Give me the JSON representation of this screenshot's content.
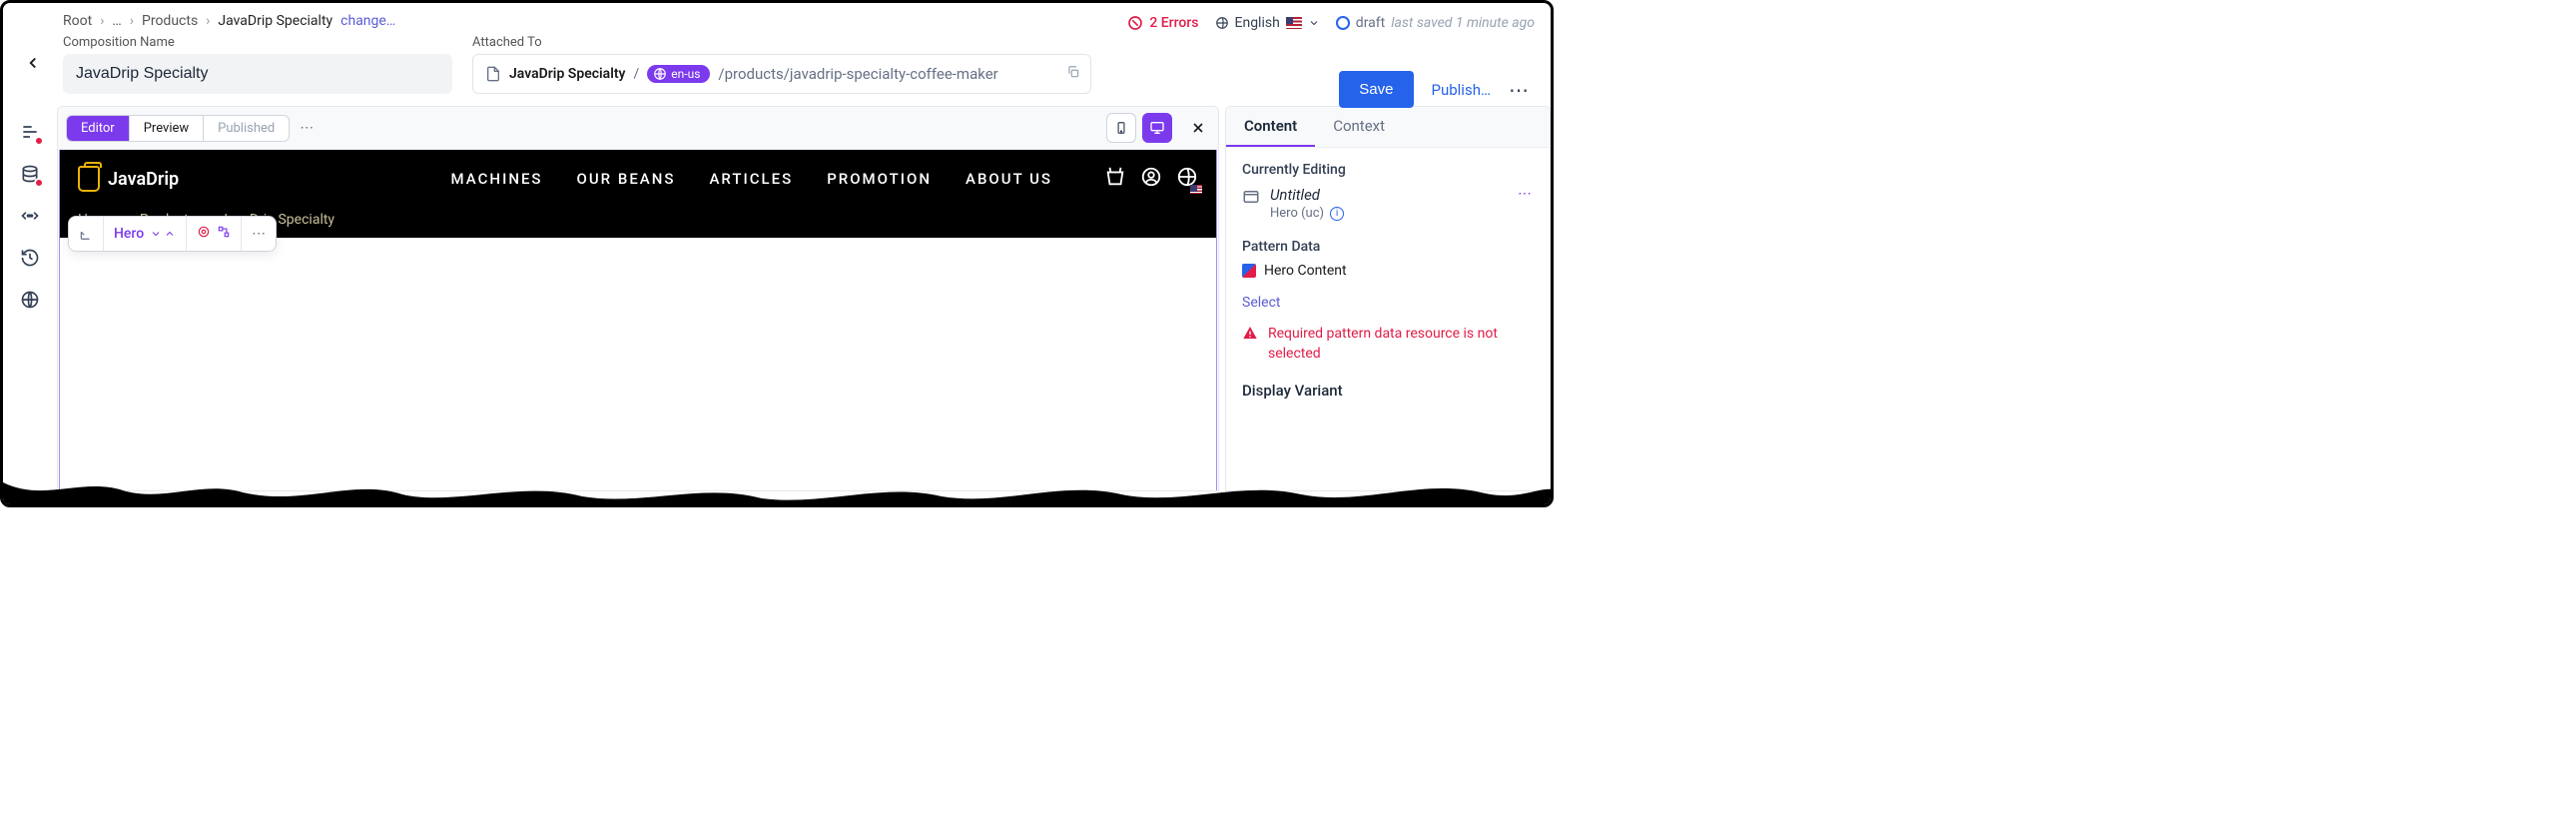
{
  "breadcrumb": {
    "root": "Root",
    "mid": "…",
    "products": "Products",
    "current": "JavaDrip Specialty",
    "change": "change…"
  },
  "fields": {
    "comp_name_label": "Composition Name",
    "comp_name_value": "JavaDrip Specialty",
    "attached_label": "Attached To",
    "attached_name": "JavaDrip Specialty",
    "locale_pill": "en-us",
    "attached_path": "/products/javadrip-specialty-coffee-maker"
  },
  "header_right": {
    "errors": "2 Errors",
    "language": "English",
    "draft": "draft",
    "last_saved": "last saved 1 minute ago"
  },
  "actions": {
    "save": "Save",
    "publish": "Publish…"
  },
  "view_tabs": {
    "editor": "Editor",
    "preview": "Preview",
    "published": "Published"
  },
  "floating": {
    "label": "Hero"
  },
  "site": {
    "brand": "JavaDrip",
    "nav": [
      "MACHINES",
      "OUR BEANS",
      "ARTICLES",
      "PROMOTION",
      "ABOUT US"
    ],
    "bc_home": "Home",
    "bc_products": "Products",
    "bc_current": "JavaDrip Specialty"
  },
  "right": {
    "tab_content": "Content",
    "tab_context": "Context",
    "currently_editing": "Currently Editing",
    "editing_title": "Untitled",
    "editing_sub": "Hero (uc)",
    "pattern_data": "Pattern Data",
    "pattern_name": "Hero Content",
    "select": "Select",
    "error": "Required pattern data resource is not selected",
    "display_variant": "Display Variant"
  }
}
